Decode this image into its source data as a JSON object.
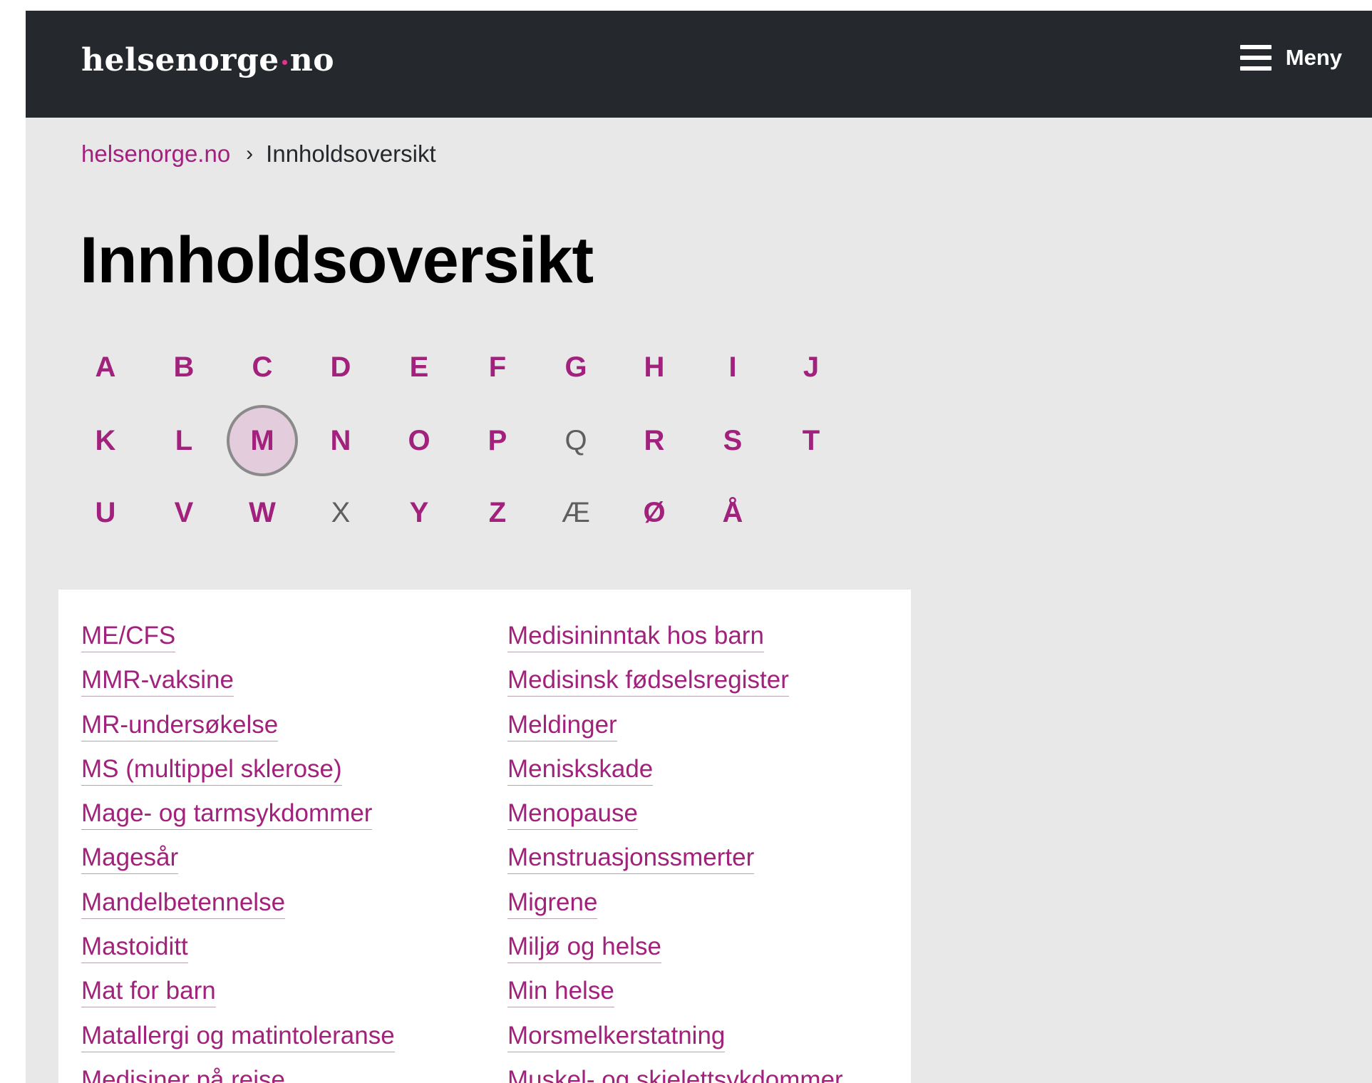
{
  "colors": {
    "accent": "#a2217c",
    "header_bg": "#25292d",
    "page_bg": "#e8e8e8",
    "dot": "#e0358f"
  },
  "header": {
    "logo_left": "helsenorge",
    "logo_right": "no",
    "menu_icon": "hamburger-menu-icon",
    "menu_label": "Meny"
  },
  "breadcrumb": {
    "home": "helsenorge.no",
    "separator_icon": "chevron-right-icon",
    "separator": "›",
    "current": "Innholdsoversikt"
  },
  "page_title": "Innholdsoversikt",
  "alphabet": {
    "selected": "M",
    "letters": [
      {
        "char": "A",
        "enabled": true
      },
      {
        "char": "B",
        "enabled": true
      },
      {
        "char": "C",
        "enabled": true
      },
      {
        "char": "D",
        "enabled": true
      },
      {
        "char": "E",
        "enabled": true
      },
      {
        "char": "F",
        "enabled": true
      },
      {
        "char": "G",
        "enabled": true
      },
      {
        "char": "H",
        "enabled": true
      },
      {
        "char": "I",
        "enabled": true
      },
      {
        "char": "J",
        "enabled": true
      },
      {
        "char": "K",
        "enabled": true
      },
      {
        "char": "L",
        "enabled": true
      },
      {
        "char": "M",
        "enabled": true
      },
      {
        "char": "N",
        "enabled": true
      },
      {
        "char": "O",
        "enabled": true
      },
      {
        "char": "P",
        "enabled": true
      },
      {
        "char": "Q",
        "enabled": false
      },
      {
        "char": "R",
        "enabled": true
      },
      {
        "char": "S",
        "enabled": true
      },
      {
        "char": "T",
        "enabled": true
      },
      {
        "char": "U",
        "enabled": true
      },
      {
        "char": "V",
        "enabled": true
      },
      {
        "char": "W",
        "enabled": true
      },
      {
        "char": "X",
        "enabled": false
      },
      {
        "char": "Y",
        "enabled": true
      },
      {
        "char": "Z",
        "enabled": true
      },
      {
        "char": "Æ",
        "enabled": false
      },
      {
        "char": "Ø",
        "enabled": true
      },
      {
        "char": "Å",
        "enabled": true
      }
    ]
  },
  "topics": {
    "left": [
      "ME/CFS",
      "MMR-vaksine",
      "MR-undersøkelse",
      "MS (multippel sklerose)",
      "Mage- og tarmsykdommer",
      "Magesår",
      "Mandelbetennelse",
      "Mastoiditt",
      "Mat for barn",
      "Matallergi og matintoleranse",
      "Medisiner på reise"
    ],
    "right": [
      "Medisininntak hos barn",
      "Medisinsk fødselsregister",
      "Meldinger",
      "Meniskskade",
      "Menopause",
      "Menstruasjonssmerter",
      "Migrene",
      "Miljø og helse",
      "Min helse",
      "Morsmelkerstatning",
      "Muskel- og skjelettsykdommer"
    ]
  }
}
